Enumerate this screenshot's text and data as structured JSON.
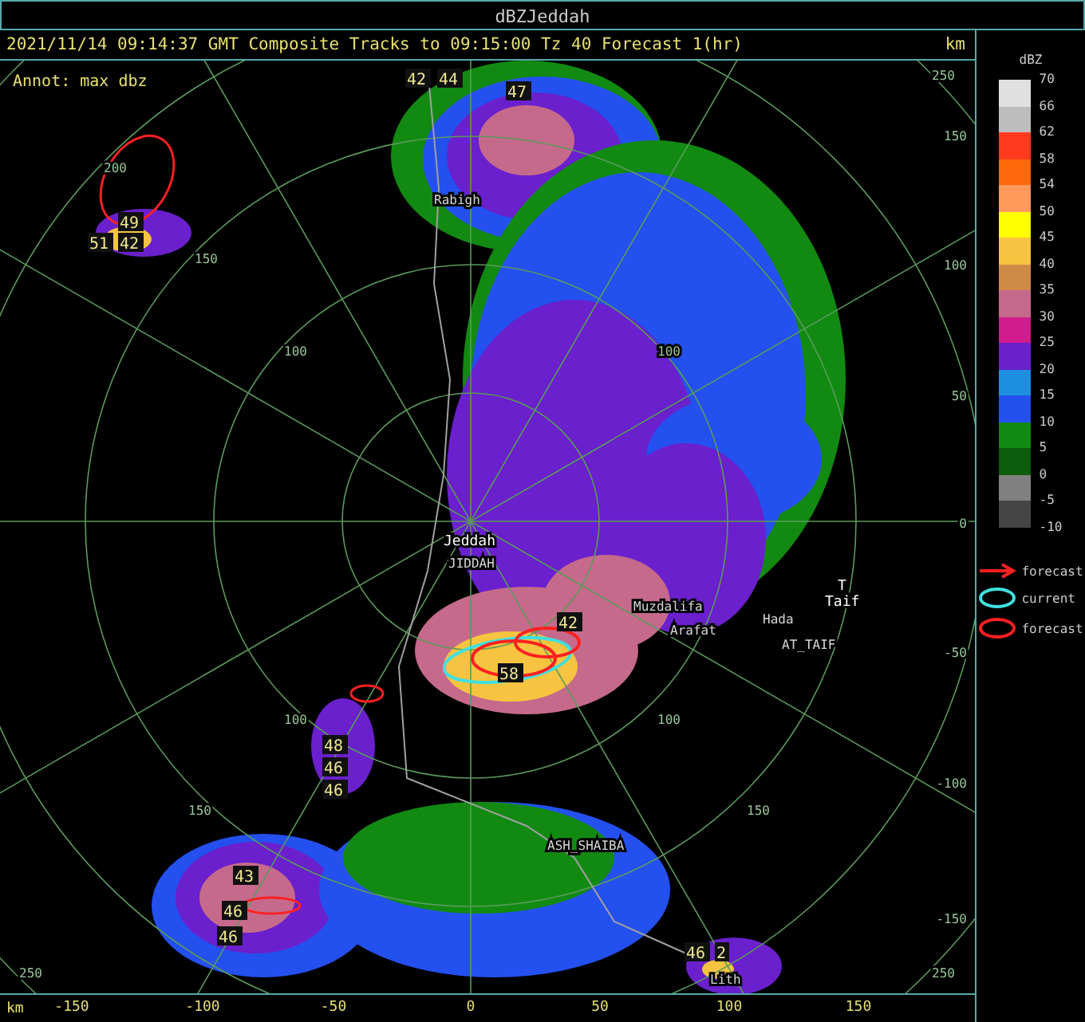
{
  "window": {
    "title": "dBZJeddah"
  },
  "header": {
    "text": "2021/11/14 09:14:37 GMT Composite Tracks to 09:15:00 Tz 40 Forecast 1(hr)",
    "unit": "km"
  },
  "annotation": "Annot: max dbz",
  "places": [
    "Rabigh",
    "Jeddah",
    "JIDDAH",
    "Muzdalifa",
    "Arafat",
    "Hada",
    "AT_TAIF",
    "T",
    "Taif",
    "ASH_SHAIBA",
    "Lith"
  ],
  "cells": [
    "42",
    "44",
    "47",
    "49",
    "51",
    "42",
    "58",
    "42",
    "48",
    "46",
    "46",
    "43",
    "46",
    "46",
    "46",
    "2"
  ],
  "ring_labels": [
    "200",
    "150",
    "100",
    "100",
    "100",
    "100",
    "150",
    "150",
    "250",
    "250",
    "250"
  ],
  "y_axis": [
    "150",
    "100",
    "50",
    "0",
    "-50",
    "-100",
    "-150"
  ],
  "x_axis": {
    "unit": "km",
    "ticks": [
      "-150",
      "-100",
      "-50",
      "0",
      "50",
      "100",
      "150"
    ]
  },
  "legend": {
    "title": "dBZ",
    "bins": [
      {
        "label": "70",
        "color": "#e0e0e0"
      },
      {
        "label": "66",
        "color": "#bdbdbd"
      },
      {
        "label": "62",
        "color": "#ff3a1e"
      },
      {
        "label": "58",
        "color": "#ff680a"
      },
      {
        "label": "54",
        "color": "#ff9a5c"
      },
      {
        "label": "50",
        "color": "#ffff00"
      },
      {
        "label": "45",
        "color": "#f6c440"
      },
      {
        "label": "40",
        "color": "#d08a48"
      },
      {
        "label": "35",
        "color": "#c66a8c"
      },
      {
        "label": "30",
        "color": "#d01c8c"
      },
      {
        "label": "25",
        "color": "#6a20cc"
      },
      {
        "label": "20",
        "color": "#1e8ee0"
      },
      {
        "label": "15",
        "color": "#2450f0"
      },
      {
        "label": "10",
        "color": "#128a12"
      },
      {
        "label": "5",
        "color": "#0b5c0b"
      },
      {
        "label": "0",
        "color": "#808080"
      },
      {
        "label": "-5",
        "color": "#444444"
      }
    ],
    "bottom_label": "-10",
    "symbols": [
      {
        "kind": "arrow",
        "label": "forecast",
        "color": "#ff2020"
      },
      {
        "kind": "ellipse",
        "label": "current",
        "color": "#40e0e0"
      },
      {
        "kind": "ellipse",
        "label": "forecast",
        "color": "#ff2020"
      }
    ]
  }
}
